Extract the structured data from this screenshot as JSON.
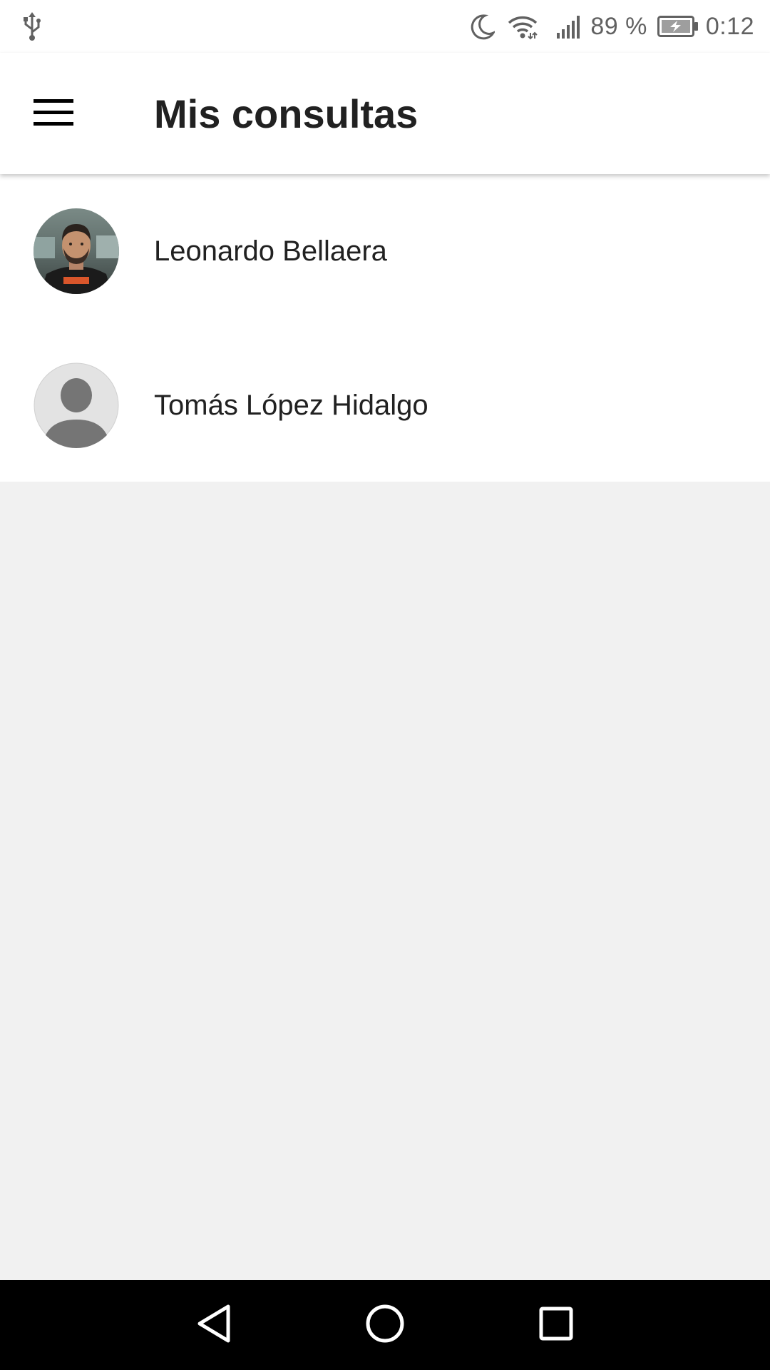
{
  "status_bar": {
    "battery_percent": "89 %",
    "time": "0:12",
    "icons": [
      "usb-icon",
      "moon-icon",
      "wifi-icon",
      "signal-icon",
      "battery-icon"
    ]
  },
  "app_bar": {
    "menu_icon": "hamburger-menu-icon",
    "title": "Mis consultas"
  },
  "contacts": [
    {
      "name": "Leonardo Bellaera",
      "avatar": "photo"
    },
    {
      "name": "Tomás López Hidalgo",
      "avatar": "default-person"
    }
  ],
  "nav_bar": {
    "icons": [
      "back-icon",
      "home-icon",
      "recents-icon"
    ]
  },
  "colors": {
    "background": "#f1f1f1",
    "surface": "#ffffff",
    "text_primary": "#212121",
    "status_text": "#616161",
    "nav_bar": "#000000"
  }
}
